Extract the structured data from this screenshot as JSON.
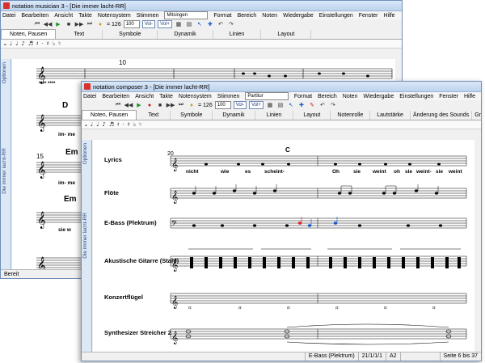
{
  "back": {
    "title": "notation musician 3 - [Die immer lacht-RR]",
    "menu": [
      "Datei",
      "Bearbeiten",
      "Ansicht",
      "Takte",
      "Notensystem",
      "Stimmen",
      "Format",
      "Bereich",
      "Noten",
      "Wiedergabe",
      "Einstellungen",
      "Fenster",
      "Hilfe"
    ],
    "voice_combo": "Mitsingen",
    "tempo": "= 126",
    "tempo_value": "100",
    "vol_minus": "Vol-",
    "vol_plus": "Vol+",
    "tabs": [
      "Noten, Pausen",
      "Text",
      "Symbole",
      "Dynamik",
      "Linien",
      "Layout"
    ],
    "side_label": "Die immer lacht-RR",
    "side_label2": "Optionen",
    "measure_10": "10",
    "measure_15": "15",
    "chord_d": "D",
    "chord_em": "Em",
    "chord_em2": "Em",
    "lyric1": "im-    me",
    "lyric2": "im-    me",
    "lyric3": "sie      w",
    "stars": "****  ****",
    "status": "Bereit"
  },
  "front": {
    "title": "notation composer 3 - [Die immer lacht-RR]",
    "menu": [
      "Datei",
      "Bearbeiten",
      "Ansicht",
      "Takte",
      "Notensystem",
      "Stimmen",
      "Format",
      "Bereich",
      "Noten",
      "Wiedergabe",
      "Einstellungen",
      "Fenster",
      "Hilfe"
    ],
    "voice_combo": "Partitur",
    "tempo": "= 126",
    "tempo_value": "100",
    "vol_minus": "Vol-",
    "vol_plus": "Vol+",
    "tabs": [
      "Noten, Pausen",
      "Text",
      "Symbole",
      "Dynamik",
      "Linien",
      "Layout",
      "Notenrolle",
      "Lautstärke",
      "Änderung des Sounds",
      "GraphOverNotes™"
    ],
    "side_label": "Die immer lacht-RR",
    "side_label2": "Optionen",
    "measure": "20",
    "chord": "C",
    "instruments": [
      "Lyrics",
      "Flöte",
      "E-Bass (Plektrum)",
      "Akustische Gitarre (Stahl)",
      "Konzertflügel",
      "Synthesizer Streicher 2"
    ],
    "lyrics": [
      "nicht",
      "wie",
      "es",
      "scheint-",
      "Oh",
      "sie",
      "weint",
      "oh",
      "sie",
      "weint-",
      "sie",
      "weint"
    ],
    "status_instrument": "E-Bass (Plektrum)",
    "status_pos": "21/1/1/1",
    "status_zoom": "A2",
    "status_page": "Seite 6 bis 37"
  },
  "icons": {
    "window_controls": [
      "minimize-icon",
      "maximize-icon",
      "close-icon"
    ],
    "transport": [
      "rewind-icon",
      "play-icon",
      "record-icon",
      "stop-icon",
      "fast-forward-icon"
    ]
  }
}
